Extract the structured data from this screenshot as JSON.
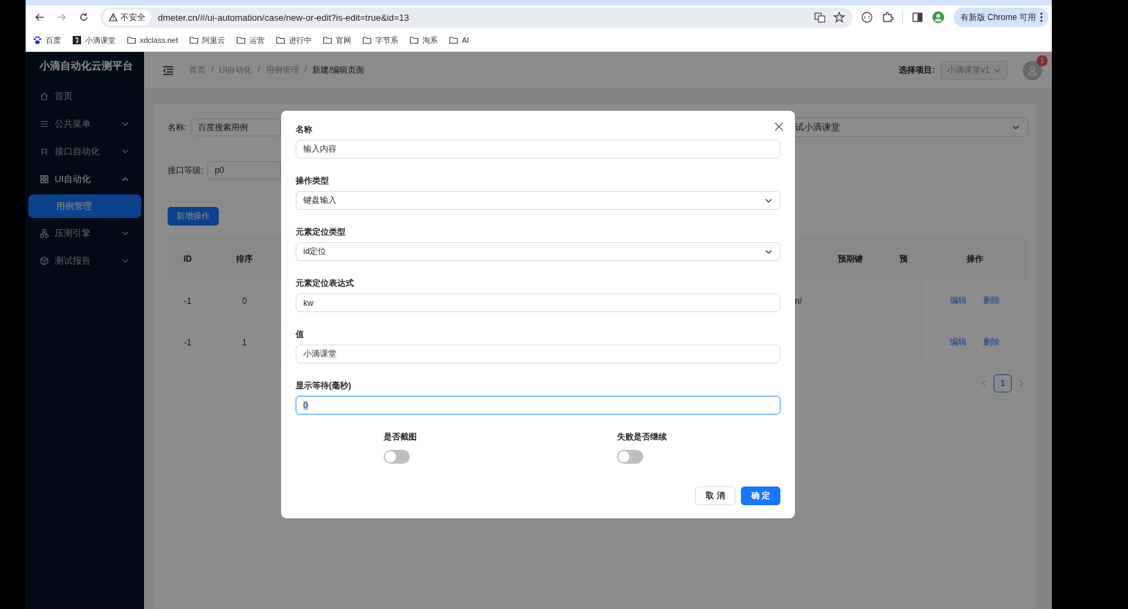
{
  "browser": {
    "security_chip": "不安全",
    "url": "dmeter.cn/#/ui-automation/case/new-or-edit?is-edit=true&id=13",
    "update_chip": "有新版 Chrome 可用"
  },
  "bookmarks": [
    {
      "label": "百度",
      "kind": "paw"
    },
    {
      "label": "小滴课堂",
      "kind": "site"
    },
    {
      "label": "xdclass.net",
      "kind": "folder"
    },
    {
      "label": "阿里云",
      "kind": "folder"
    },
    {
      "label": "运营",
      "kind": "folder"
    },
    {
      "label": "进行中",
      "kind": "folder"
    },
    {
      "label": "官网",
      "kind": "folder"
    },
    {
      "label": "字节系",
      "kind": "folder"
    },
    {
      "label": "淘系",
      "kind": "folder"
    },
    {
      "label": "AI",
      "kind": "folder"
    }
  ],
  "sidebar": {
    "title": "小滴自动化云测平台",
    "items": [
      {
        "label": "首页",
        "kind": "link",
        "selected": false
      },
      {
        "label": "公共菜单",
        "kind": "submenu",
        "expanded": false
      },
      {
        "label": "接口自动化",
        "kind": "submenu",
        "expanded": false
      },
      {
        "label": "UI自动化",
        "kind": "submenu",
        "expanded": true,
        "children": [
          {
            "label": "用例管理",
            "selected": true
          }
        ]
      },
      {
        "label": "压测引擎",
        "kind": "submenu",
        "expanded": false
      },
      {
        "label": "测试报告",
        "kind": "submenu",
        "expanded": false
      }
    ]
  },
  "header": {
    "breadcrumb": [
      {
        "label": "首页",
        "kind": "link"
      },
      {
        "label": "/",
        "kind": "separator"
      },
      {
        "label": "UI自动化",
        "kind": "link"
      },
      {
        "label": "/",
        "kind": "separator"
      },
      {
        "label": "用例管理",
        "kind": "link"
      },
      {
        "label": "/",
        "kind": "separator"
      },
      {
        "label": "新建/编辑页面",
        "kind": "current"
      }
    ],
    "project_label": "选择项目:",
    "project_select": "小滴课堂v1",
    "notification_count": "1"
  },
  "form": {
    "name_label": "名称:",
    "name_value": "百度搜索用例",
    "right_select_value": "试小滴课堂",
    "level_label": "接口等级:",
    "level_value": "p0",
    "add_button": "新增操作"
  },
  "table": {
    "columns_left": [
      "ID",
      "排序"
    ],
    "columns_right": [
      "预期键",
      "预"
    ],
    "action_column": "操作",
    "rows": [
      {
        "id": "-1",
        "order": "0",
        "partial_cell": "n/",
        "actions": [
          "编辑",
          "删除"
        ]
      },
      {
        "id": "-1",
        "order": "1",
        "actions": [
          "编辑",
          "删除"
        ]
      }
    ]
  },
  "pagination": {
    "pages": [
      {
        "label": "1",
        "selected": true
      }
    ]
  },
  "dialog": {
    "fields": [
      {
        "label": "名称",
        "kind": "input",
        "value": "输入内容",
        "focused": false
      },
      {
        "label": "操作类型",
        "kind": "select",
        "value": "键盘输入",
        "focused": false
      },
      {
        "label": "元素定位类型",
        "kind": "select",
        "value": "id定位",
        "focused": false
      },
      {
        "label": "元素定位表达式",
        "kind": "input",
        "value": "kw",
        "focused": false
      },
      {
        "label": "值",
        "kind": "input",
        "value": "小滴课堂",
        "focused": false
      },
      {
        "label": "显示等待(毫秒)",
        "kind": "input",
        "value": "0",
        "focused": true
      }
    ],
    "switches": [
      {
        "label": "是否截图",
        "on": false
      },
      {
        "label": "失败是否继续",
        "on": false
      }
    ],
    "buttons": [
      {
        "label": "取 消",
        "kind": "default"
      },
      {
        "label": "确 定",
        "kind": "primary"
      }
    ]
  }
}
